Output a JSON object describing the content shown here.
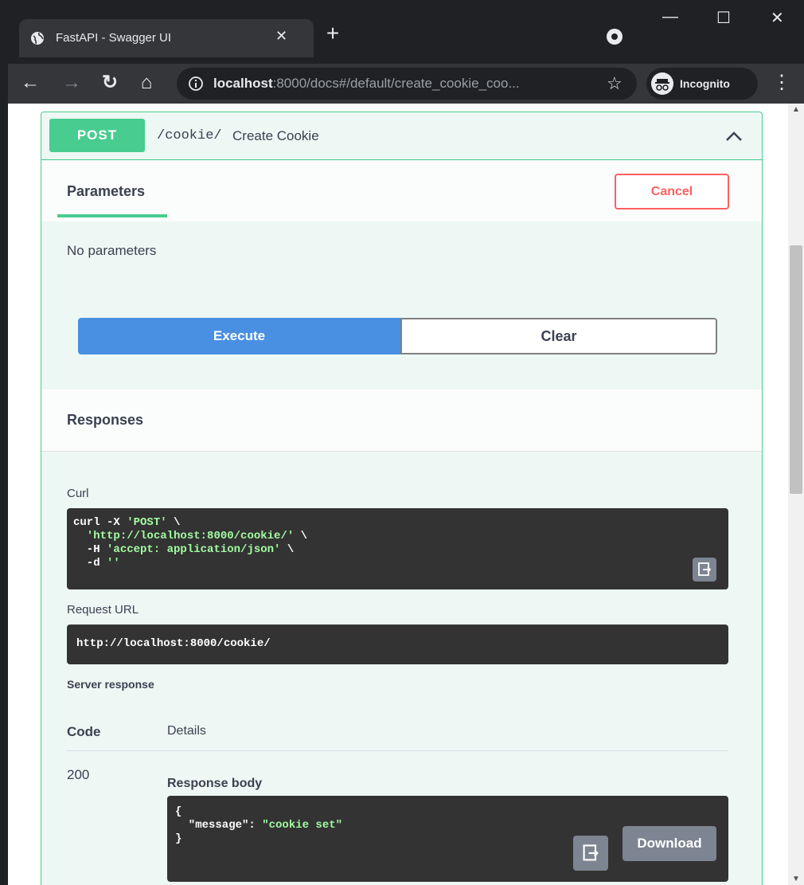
{
  "browser": {
    "tab_title": "FastAPI - Swagger UI",
    "tab_close": "✕",
    "new_tab": "+",
    "url_host": "localhost",
    "url_rest": ":8000/docs#/default/create_cookie_coo...",
    "incognito_label": "Incognito",
    "back": "←",
    "forward": "→",
    "reload": "↻",
    "home": "⌂",
    "star": "☆",
    "menu": "⋮",
    "minimize": "—",
    "maximize": "☐",
    "close": "✕"
  },
  "operation": {
    "method": "POST",
    "path": "/cookie/",
    "summary": "Create Cookie",
    "accent_color": "#49cc90"
  },
  "parameters": {
    "title": "Parameters",
    "cancel_label": "Cancel",
    "empty_text": "No parameters"
  },
  "actions": {
    "execute_label": "Execute",
    "clear_label": "Clear"
  },
  "responses": {
    "title": "Responses",
    "curl_label": "Curl",
    "curl_lines": {
      "l1_a": "curl -X ",
      "l1_b": "'POST'",
      "l1_c": " \\",
      "l2_a": "  ",
      "l2_b": "'http://localhost:8000/cookie/'",
      "l2_c": " \\",
      "l3_a": "  -H ",
      "l3_b": "'accept: application/json'",
      "l3_c": " \\",
      "l4_a": "  -d ",
      "l4_b": "''"
    },
    "request_url_label": "Request URL",
    "request_url": "http://localhost:8000/cookie/",
    "server_response_label": "Server response",
    "col_code": "Code",
    "col_details": "Details",
    "status_code": "200",
    "response_body_label": "Response body",
    "body_lines": {
      "l1": "{",
      "l2_key": "  \"message\": ",
      "l2_val": "\"cookie set\"",
      "l3": "}"
    },
    "download_label": "Download"
  }
}
